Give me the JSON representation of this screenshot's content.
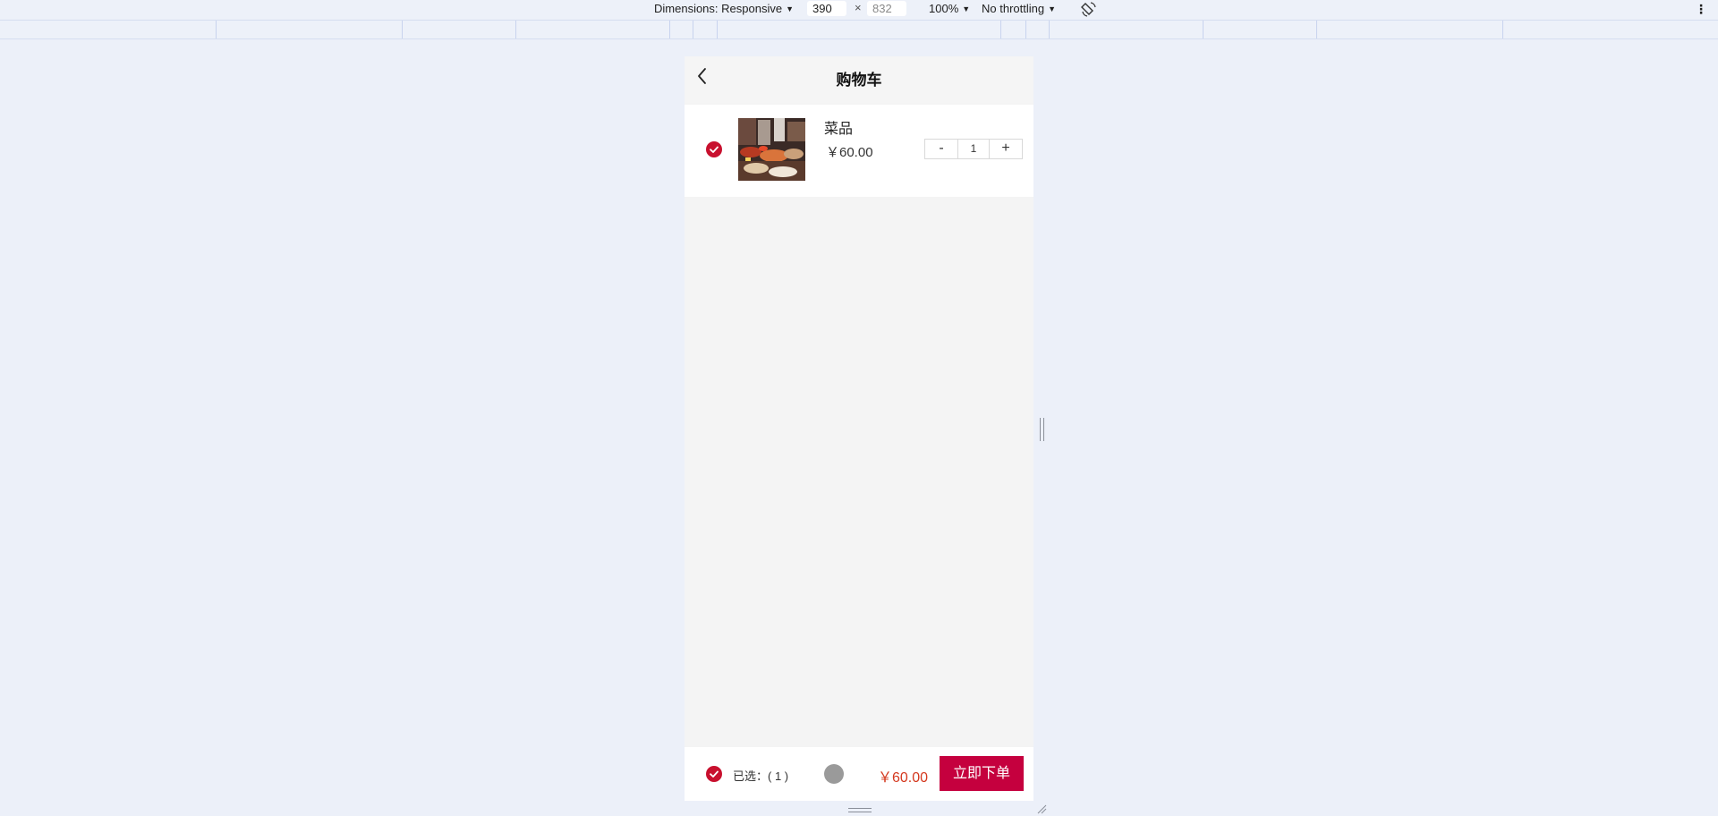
{
  "devtools": {
    "dimensions_label": "Dimensions: Responsive",
    "width_value": "390",
    "times_sign": "×",
    "height_placeholder": "832",
    "zoom_label": "100%",
    "throttling_label": "No throttling",
    "icons": [
      "rotate-icon",
      "more-vert-icon",
      "chevron-down-icon"
    ]
  },
  "header": {
    "title": "购物车",
    "back_icon": "chevron-left-icon"
  },
  "cart": {
    "items": [
      {
        "name": "菜品",
        "price": "￥60.00",
        "quantity": "1",
        "minus_label": "-",
        "plus_label": "+",
        "checked": true
      }
    ]
  },
  "footer": {
    "selected_label": "已选：( 1 )",
    "total": "￥60.00",
    "order_button": "立即下单",
    "check_icon": "check-circle-icon"
  },
  "colors": {
    "accent_red": "#c8102e",
    "button_red": "#c5003e",
    "price_red": "#d4381e",
    "page_bg": "#f4f4f4",
    "devtools_bg": "#ecf0f9"
  }
}
